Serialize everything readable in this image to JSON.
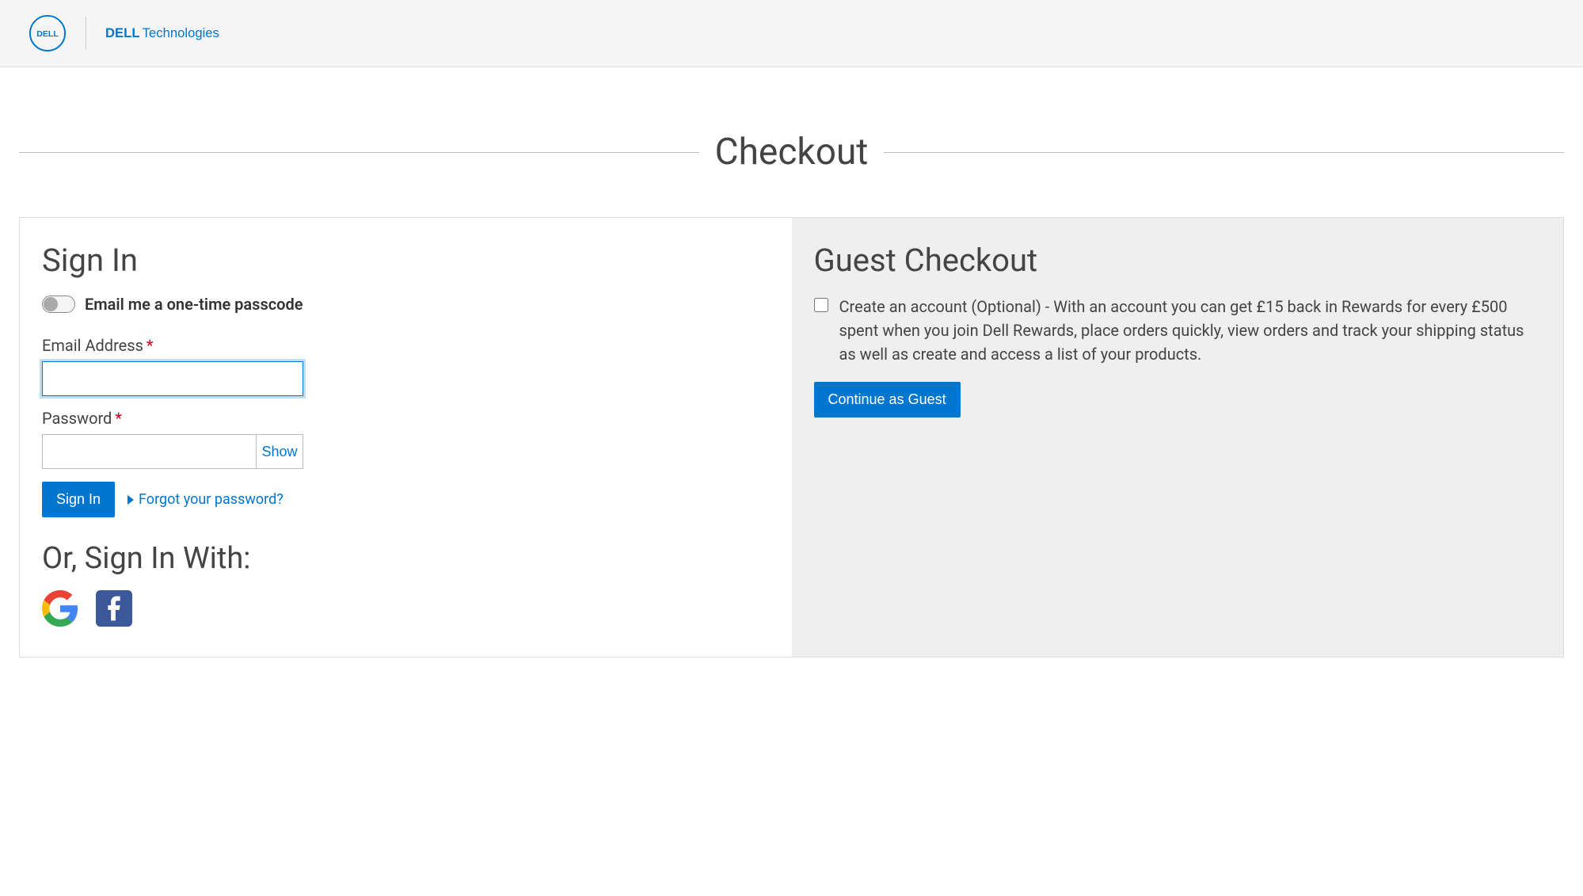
{
  "header": {
    "logo_text": "DELL",
    "brand_text_bold": "DELL",
    "brand_text_light": "Technologies"
  },
  "page": {
    "title": "Checkout"
  },
  "signin": {
    "title": "Sign In",
    "toggle_label": "Email me a one-time passcode",
    "email_label": "Email Address",
    "password_label": "Password",
    "show_label": "Show",
    "button_label": "Sign In",
    "forgot_label": "Forgot your password?",
    "or_title": "Or, Sign In With:"
  },
  "guest": {
    "title": "Guest Checkout",
    "checkbox_text": "Create an account (Optional) - With an account you can get £15 back in Rewards for every £500 spent when you join Dell Rewards, place orders quickly, view orders and track your shipping status as well as create and access a list of your products.",
    "button_label": "Continue as Guest"
  }
}
